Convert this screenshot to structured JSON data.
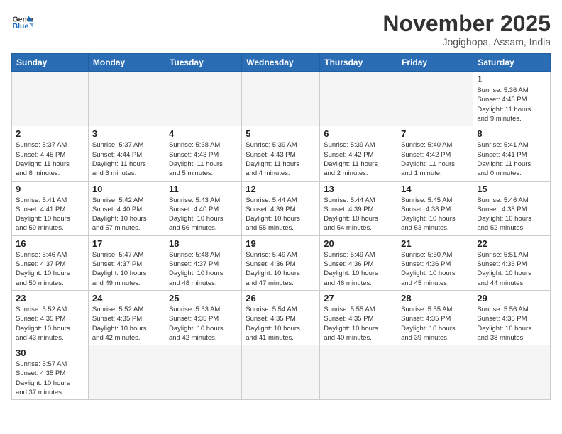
{
  "logo": {
    "text_general": "General",
    "text_blue": "Blue"
  },
  "header": {
    "month": "November 2025",
    "location": "Jogighopa, Assam, India"
  },
  "weekdays": [
    "Sunday",
    "Monday",
    "Tuesday",
    "Wednesday",
    "Thursday",
    "Friday",
    "Saturday"
  ],
  "weeks": [
    [
      {
        "day": "",
        "info": ""
      },
      {
        "day": "",
        "info": ""
      },
      {
        "day": "",
        "info": ""
      },
      {
        "day": "",
        "info": ""
      },
      {
        "day": "",
        "info": ""
      },
      {
        "day": "",
        "info": ""
      },
      {
        "day": "1",
        "info": "Sunrise: 5:36 AM\nSunset: 4:45 PM\nDaylight: 11 hours\nand 9 minutes."
      }
    ],
    [
      {
        "day": "2",
        "info": "Sunrise: 5:37 AM\nSunset: 4:45 PM\nDaylight: 11 hours\nand 8 minutes."
      },
      {
        "day": "3",
        "info": "Sunrise: 5:37 AM\nSunset: 4:44 PM\nDaylight: 11 hours\nand 6 minutes."
      },
      {
        "day": "4",
        "info": "Sunrise: 5:38 AM\nSunset: 4:43 PM\nDaylight: 11 hours\nand 5 minutes."
      },
      {
        "day": "5",
        "info": "Sunrise: 5:39 AM\nSunset: 4:43 PM\nDaylight: 11 hours\nand 4 minutes."
      },
      {
        "day": "6",
        "info": "Sunrise: 5:39 AM\nSunset: 4:42 PM\nDaylight: 11 hours\nand 2 minutes."
      },
      {
        "day": "7",
        "info": "Sunrise: 5:40 AM\nSunset: 4:42 PM\nDaylight: 11 hours\nand 1 minute."
      },
      {
        "day": "8",
        "info": "Sunrise: 5:41 AM\nSunset: 4:41 PM\nDaylight: 11 hours\nand 0 minutes."
      }
    ],
    [
      {
        "day": "9",
        "info": "Sunrise: 5:41 AM\nSunset: 4:41 PM\nDaylight: 10 hours\nand 59 minutes."
      },
      {
        "day": "10",
        "info": "Sunrise: 5:42 AM\nSunset: 4:40 PM\nDaylight: 10 hours\nand 57 minutes."
      },
      {
        "day": "11",
        "info": "Sunrise: 5:43 AM\nSunset: 4:40 PM\nDaylight: 10 hours\nand 56 minutes."
      },
      {
        "day": "12",
        "info": "Sunrise: 5:44 AM\nSunset: 4:39 PM\nDaylight: 10 hours\nand 55 minutes."
      },
      {
        "day": "13",
        "info": "Sunrise: 5:44 AM\nSunset: 4:39 PM\nDaylight: 10 hours\nand 54 minutes."
      },
      {
        "day": "14",
        "info": "Sunrise: 5:45 AM\nSunset: 4:38 PM\nDaylight: 10 hours\nand 53 minutes."
      },
      {
        "day": "15",
        "info": "Sunrise: 5:46 AM\nSunset: 4:38 PM\nDaylight: 10 hours\nand 52 minutes."
      }
    ],
    [
      {
        "day": "16",
        "info": "Sunrise: 5:46 AM\nSunset: 4:37 PM\nDaylight: 10 hours\nand 50 minutes."
      },
      {
        "day": "17",
        "info": "Sunrise: 5:47 AM\nSunset: 4:37 PM\nDaylight: 10 hours\nand 49 minutes."
      },
      {
        "day": "18",
        "info": "Sunrise: 5:48 AM\nSunset: 4:37 PM\nDaylight: 10 hours\nand 48 minutes."
      },
      {
        "day": "19",
        "info": "Sunrise: 5:49 AM\nSunset: 4:36 PM\nDaylight: 10 hours\nand 47 minutes."
      },
      {
        "day": "20",
        "info": "Sunrise: 5:49 AM\nSunset: 4:36 PM\nDaylight: 10 hours\nand 46 minutes."
      },
      {
        "day": "21",
        "info": "Sunrise: 5:50 AM\nSunset: 4:36 PM\nDaylight: 10 hours\nand 45 minutes."
      },
      {
        "day": "22",
        "info": "Sunrise: 5:51 AM\nSunset: 4:36 PM\nDaylight: 10 hours\nand 44 minutes."
      }
    ],
    [
      {
        "day": "23",
        "info": "Sunrise: 5:52 AM\nSunset: 4:35 PM\nDaylight: 10 hours\nand 43 minutes."
      },
      {
        "day": "24",
        "info": "Sunrise: 5:52 AM\nSunset: 4:35 PM\nDaylight: 10 hours\nand 42 minutes."
      },
      {
        "day": "25",
        "info": "Sunrise: 5:53 AM\nSunset: 4:35 PM\nDaylight: 10 hours\nand 42 minutes."
      },
      {
        "day": "26",
        "info": "Sunrise: 5:54 AM\nSunset: 4:35 PM\nDaylight: 10 hours\nand 41 minutes."
      },
      {
        "day": "27",
        "info": "Sunrise: 5:55 AM\nSunset: 4:35 PM\nDaylight: 10 hours\nand 40 minutes."
      },
      {
        "day": "28",
        "info": "Sunrise: 5:55 AM\nSunset: 4:35 PM\nDaylight: 10 hours\nand 39 minutes."
      },
      {
        "day": "29",
        "info": "Sunrise: 5:56 AM\nSunset: 4:35 PM\nDaylight: 10 hours\nand 38 minutes."
      }
    ],
    [
      {
        "day": "30",
        "info": "Sunrise: 5:57 AM\nSunset: 4:35 PM\nDaylight: 10 hours\nand 37 minutes."
      },
      {
        "day": "",
        "info": ""
      },
      {
        "day": "",
        "info": ""
      },
      {
        "day": "",
        "info": ""
      },
      {
        "day": "",
        "info": ""
      },
      {
        "day": "",
        "info": ""
      },
      {
        "day": "",
        "info": ""
      }
    ]
  ]
}
